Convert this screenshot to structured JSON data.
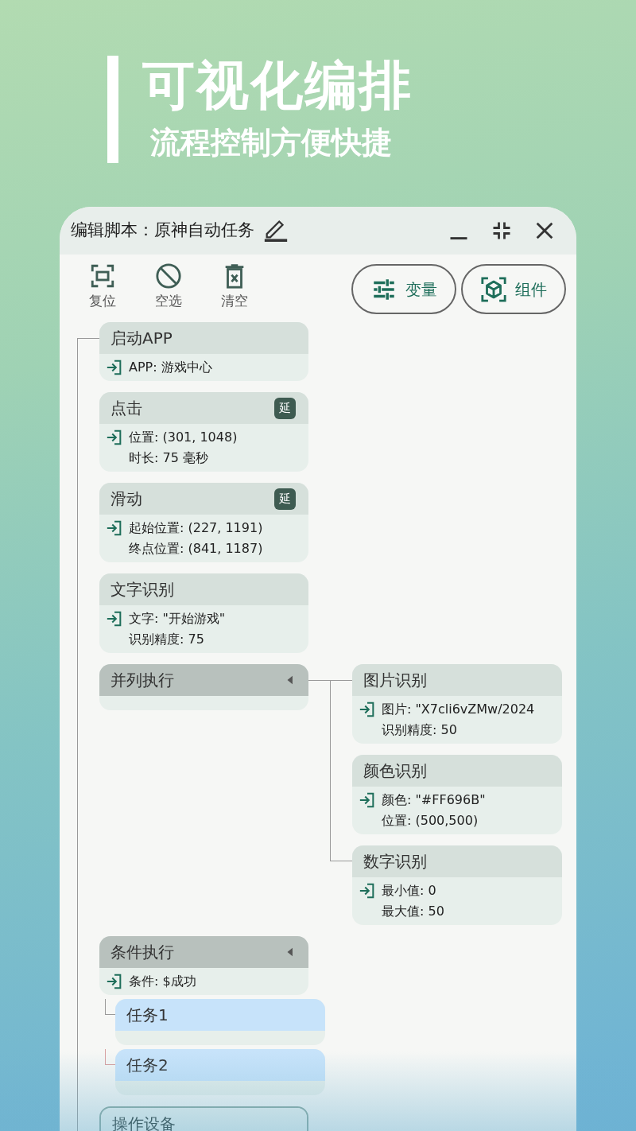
{
  "headline": {
    "title": "可视化编排",
    "subtitle": "流程控制方便快捷"
  },
  "editor": {
    "title": "编辑脚本：原神自动任务"
  },
  "toolbar": [
    {
      "kind": "reset",
      "label": "复位"
    },
    {
      "kind": "deselect",
      "label": "空选"
    },
    {
      "kind": "clear",
      "label": "清空"
    }
  ],
  "panel_buttons": [
    {
      "kind": "variables",
      "label": "变量"
    },
    {
      "kind": "components",
      "label": "组件"
    }
  ],
  "flow": [
    {
      "kind": "action",
      "title": "启动APP",
      "params": [
        "APP: 游戏中心"
      ]
    },
    {
      "kind": "action",
      "title": "点击",
      "badge": "延",
      "params": [
        "位置: (301, 1048)",
        "时长: 75 毫秒"
      ]
    },
    {
      "kind": "action",
      "title": "滑动",
      "badge": "延",
      "params": [
        "起始位置: (227, 1191)",
        "终点位置: (841, 1187)"
      ]
    },
    {
      "kind": "action",
      "title": "文字识别",
      "params": [
        "文字: \"开始游戏\"",
        "识别精度: 75"
      ]
    },
    {
      "kind": "parallel",
      "title": "并列执行",
      "children": [
        {
          "kind": "action",
          "title": "图片识别",
          "params": [
            "图片: \"X7cli6vZMw/2024",
            "识别精度: 50"
          ]
        },
        {
          "kind": "action",
          "title": "颜色识别",
          "params": [
            "颜色: \"#FF696B\"",
            "位置: (500,500)"
          ]
        },
        {
          "kind": "action",
          "title": "数字识别",
          "params": [
            "最小值: 0",
            "最大值: 50"
          ]
        }
      ]
    },
    {
      "kind": "condition",
      "title": "条件执行",
      "params": [
        "条件: $成功"
      ],
      "children": [
        {
          "kind": "task",
          "title": "任务1"
        },
        {
          "kind": "task",
          "title": "任务2"
        }
      ]
    },
    {
      "kind": "device",
      "title": "操作设备"
    }
  ]
}
